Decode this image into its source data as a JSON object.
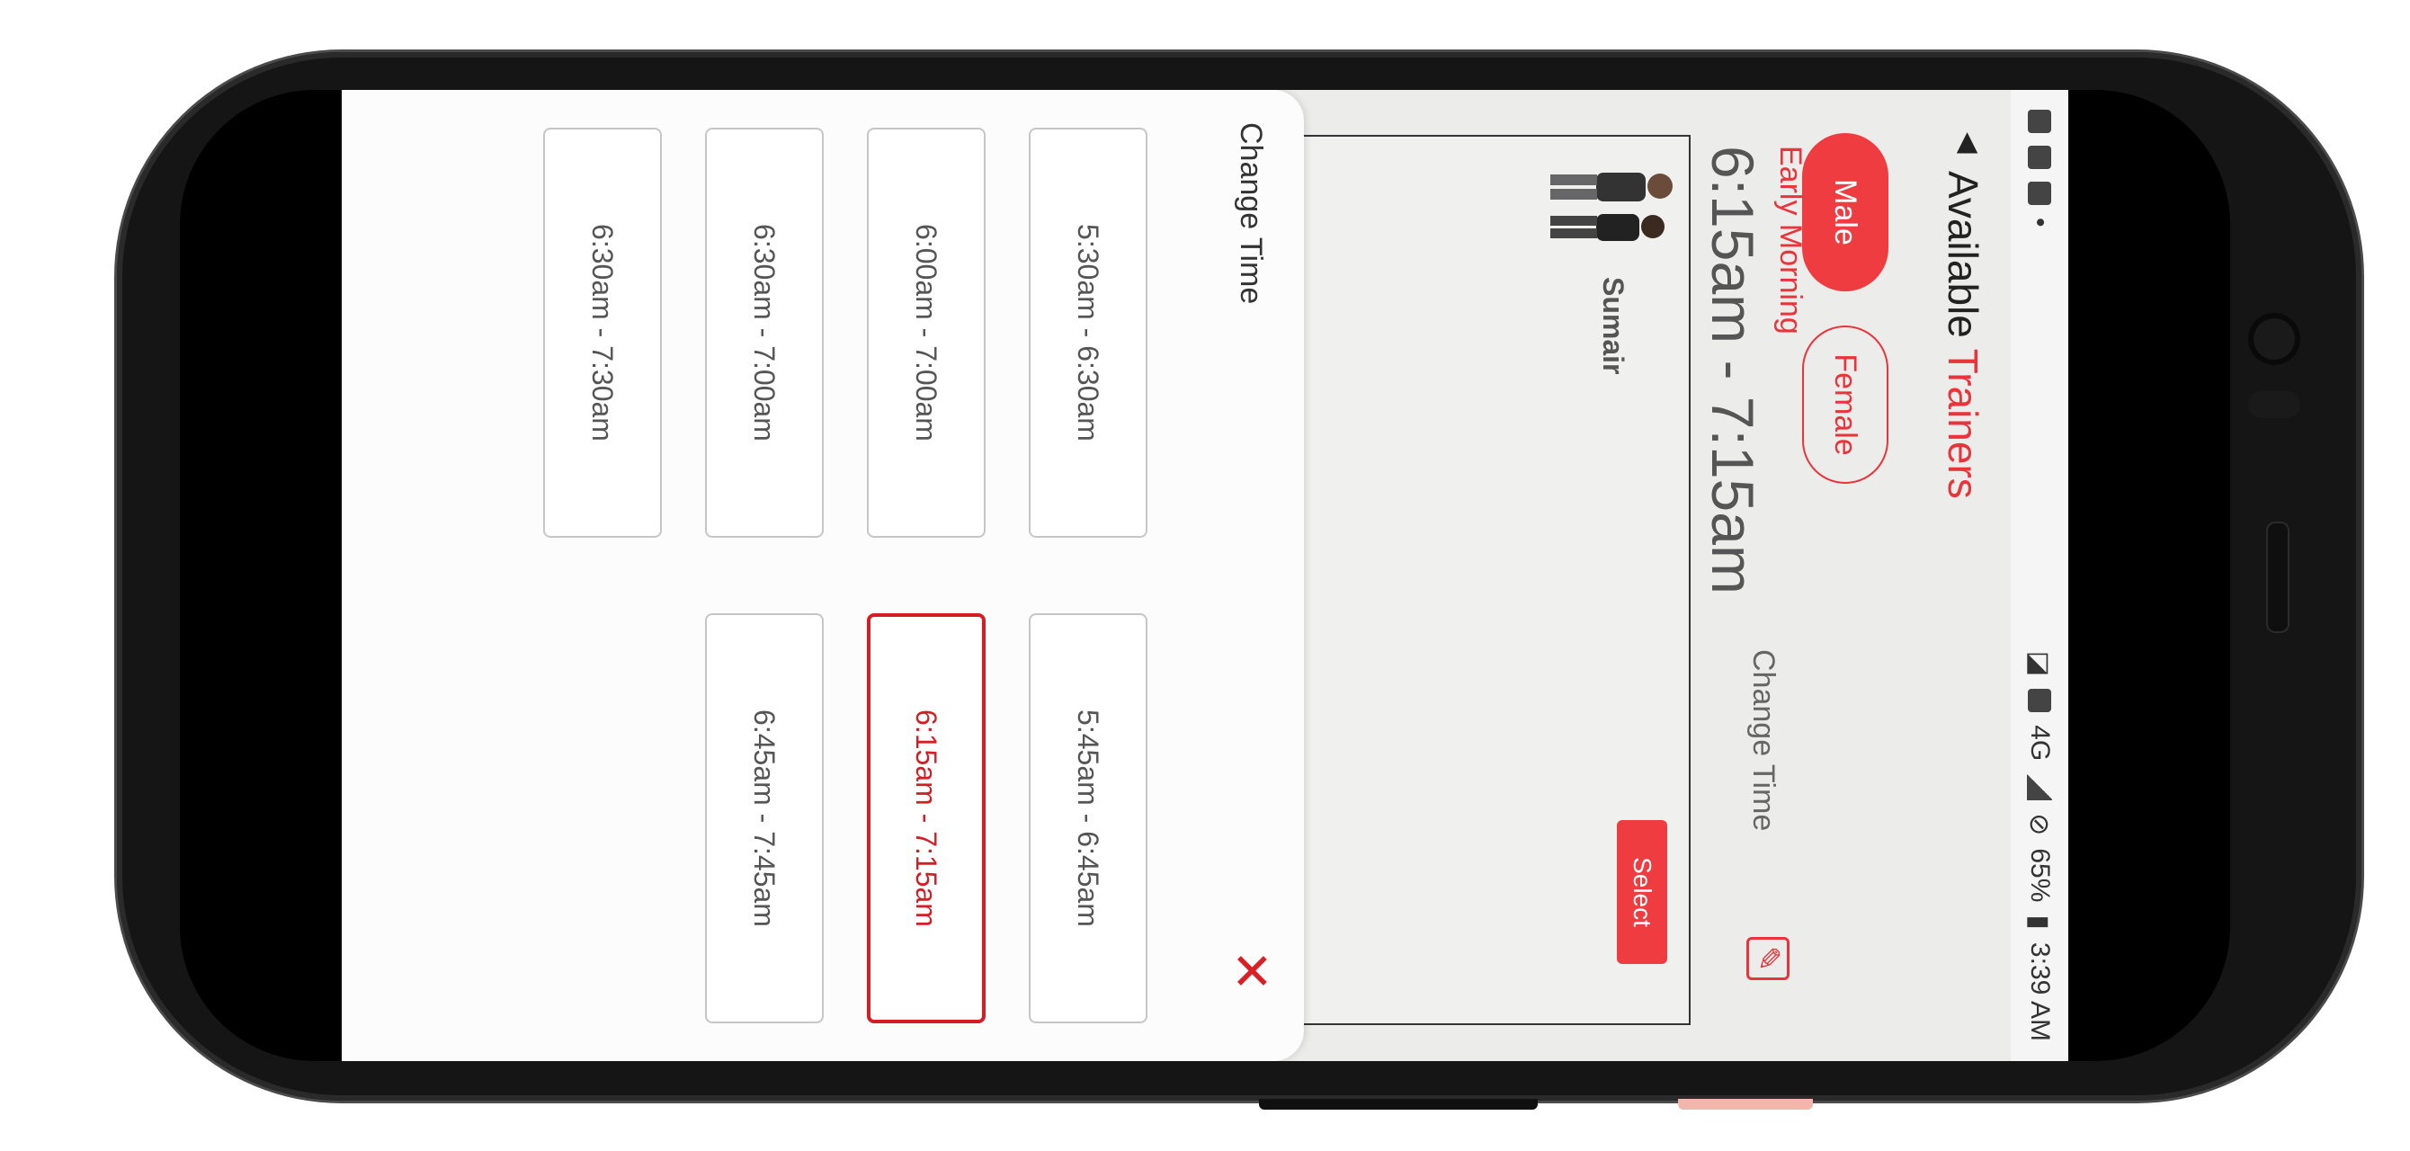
{
  "status_bar": {
    "time": "3:39 AM",
    "battery": "65%",
    "network": "4G"
  },
  "header": {
    "title_plain": "Available ",
    "title_accent": "Trainers"
  },
  "gender_filter": {
    "options": [
      "Male",
      "Female"
    ],
    "selected": "Male"
  },
  "schedule": {
    "period": "Early Morning",
    "time": "6:15am - 7:15am",
    "change_time_label": "Change Time"
  },
  "trainer_card": {
    "name": "Sumair",
    "select_label": "Select"
  },
  "change_time_sheet": {
    "title": "Change Time",
    "slots": [
      "5:30am - 6:30am",
      "5:45am - 6:45am",
      "6:00am - 7:00am",
      "6:15am - 7:15am",
      "6:30am - 7:00am",
      "6:45am - 7:45am",
      "6:30am - 7:30am"
    ],
    "selected_slot": "6:15am - 7:15am"
  },
  "colors": {
    "accent": "#e8343a",
    "selected_border": "#d51d24",
    "sheet_bg": "#fcfcfc",
    "screen_bg": "#ececeb"
  },
  "icons": {
    "back": "triangle-up-icon",
    "close": "close-icon",
    "edit": "edit-pencil-icon"
  }
}
